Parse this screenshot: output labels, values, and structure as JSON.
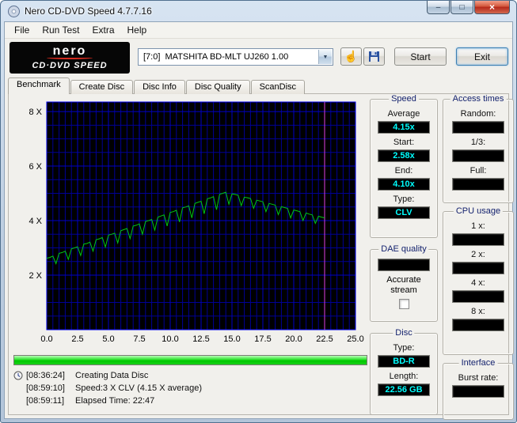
{
  "window": {
    "title": "Nero CD-DVD Speed 4.7.7.16",
    "controls": {
      "minimize": "–",
      "maximize": "□",
      "close": "×"
    }
  },
  "menubar": {
    "items": [
      "File",
      "Run Test",
      "Extra",
      "Help"
    ]
  },
  "toolbar": {
    "brand_name": "nero",
    "brand_product": "CD·DVD SPEED",
    "drive": "[7:0]  MATSHITA BD-MLT UJ260 1.00",
    "dropdown_arrow": "▼",
    "options_icon_glyph": "☝",
    "start": "Start",
    "exit": "Exit"
  },
  "tabs": {
    "items": [
      "Benchmark",
      "Create Disc",
      "Disc Info",
      "Disc Quality",
      "ScanDisc"
    ],
    "active": "Benchmark"
  },
  "panels": {
    "speed": {
      "title": "Speed",
      "rows": [
        {
          "label": "Average",
          "value": "4.15x"
        },
        {
          "label": "Start:",
          "value": "2.58x"
        },
        {
          "label": "End:",
          "value": "4.10x"
        },
        {
          "label": "Type:",
          "value": "CLV"
        }
      ]
    },
    "access_times": {
      "title": "Access times",
      "rows": [
        {
          "label": "Random:",
          "value": ""
        },
        {
          "label": "1/3:",
          "value": ""
        },
        {
          "label": "Full:",
          "value": ""
        }
      ]
    },
    "cpu": {
      "title": "CPU usage",
      "rows": [
        {
          "label": "1 x:",
          "value": ""
        },
        {
          "label": "2 x:",
          "value": ""
        },
        {
          "label": "4 x:",
          "value": ""
        },
        {
          "label": "8 x:",
          "value": ""
        }
      ]
    },
    "dae": {
      "title": "DAE quality",
      "value": "",
      "accurate_stream_line1": "Accurate",
      "accurate_stream_line2": "stream",
      "checkbox_checked": false
    },
    "disc": {
      "title": "Disc",
      "rows": [
        {
          "label": "Type:",
          "value": "BD-R"
        },
        {
          "label": "Length:",
          "value": "22.56 GB"
        }
      ]
    },
    "interface": {
      "title": "Interface",
      "rows": [
        {
          "label": "Burst rate:",
          "value": ""
        }
      ]
    }
  },
  "progress": {
    "percent": 100,
    "color": "#00c800"
  },
  "log": [
    {
      "time": "[08:36:24]",
      "text": "Creating Data Disc",
      "icon": "clock-icon"
    },
    {
      "time": "[08:59:10]",
      "text": "Speed:3 X CLV (4.15 X average)",
      "icon": ""
    },
    {
      "time": "[08:59:11]",
      "text": "Elapsed Time: 22:47",
      "icon": ""
    }
  ],
  "chart_data": {
    "type": "line",
    "title": "",
    "xlabel": "",
    "ylabel": "",
    "xlim": [
      0,
      25
    ],
    "ylim": [
      0,
      8.35
    ],
    "x_ticks": [
      0,
      2.5,
      5,
      7.5,
      10,
      12.5,
      15,
      17.5,
      20,
      22.5,
      25
    ],
    "x_tick_labels": [
      "0.0",
      "2.5",
      "5.0",
      "7.5",
      "10.0",
      "12.5",
      "15.0",
      "17.5",
      "20.0",
      "22.5",
      "25.0"
    ],
    "y_ticks": [
      2,
      4,
      6,
      8
    ],
    "y_tick_labels": [
      "2 X",
      "4 X",
      "6 X",
      "8 X"
    ],
    "grid": {
      "x_minor": 0.5,
      "x_major": 2.5,
      "y_minor": 0.5,
      "y_major": 2
    },
    "marker_x": 22.5,
    "series": [
      {
        "name": "read-speed",
        "x_start": 0,
        "x_step": 0.25,
        "values": [
          2.62,
          2.65,
          2.7,
          2.42,
          2.8,
          2.83,
          2.88,
          2.58,
          2.97,
          3.0,
          3.04,
          2.72,
          3.14,
          3.16,
          3.21,
          2.88,
          3.3,
          3.33,
          3.38,
          3.03,
          3.47,
          3.5,
          3.54,
          3.18,
          3.63,
          3.67,
          3.71,
          3.34,
          3.8,
          3.83,
          3.88,
          3.5,
          3.97,
          4.0,
          4.04,
          3.65,
          4.13,
          4.17,
          4.21,
          3.8,
          4.3,
          4.33,
          4.38,
          3.95,
          4.47,
          4.5,
          4.54,
          4.1,
          4.63,
          4.67,
          4.71,
          4.25,
          4.8,
          4.83,
          4.88,
          4.4,
          4.97,
          5.0,
          5.04,
          4.6,
          4.98,
          4.96,
          4.93,
          4.55,
          4.86,
          4.84,
          4.81,
          4.45,
          4.75,
          4.72,
          4.69,
          4.33,
          4.63,
          4.6,
          4.57,
          4.22,
          4.51,
          4.48,
          4.45,
          4.1,
          4.39,
          4.36,
          4.33,
          4.0,
          4.28,
          4.24,
          4.21,
          3.9,
          4.16,
          4.13,
          4.1
        ]
      }
    ],
    "colors": {
      "background": "#000000",
      "grid_minor": "#000096",
      "grid_major": "#0000c8",
      "border": "#0000ee",
      "line": "#00c814",
      "marker": "#e040e0",
      "tick_text": "#000000"
    }
  }
}
